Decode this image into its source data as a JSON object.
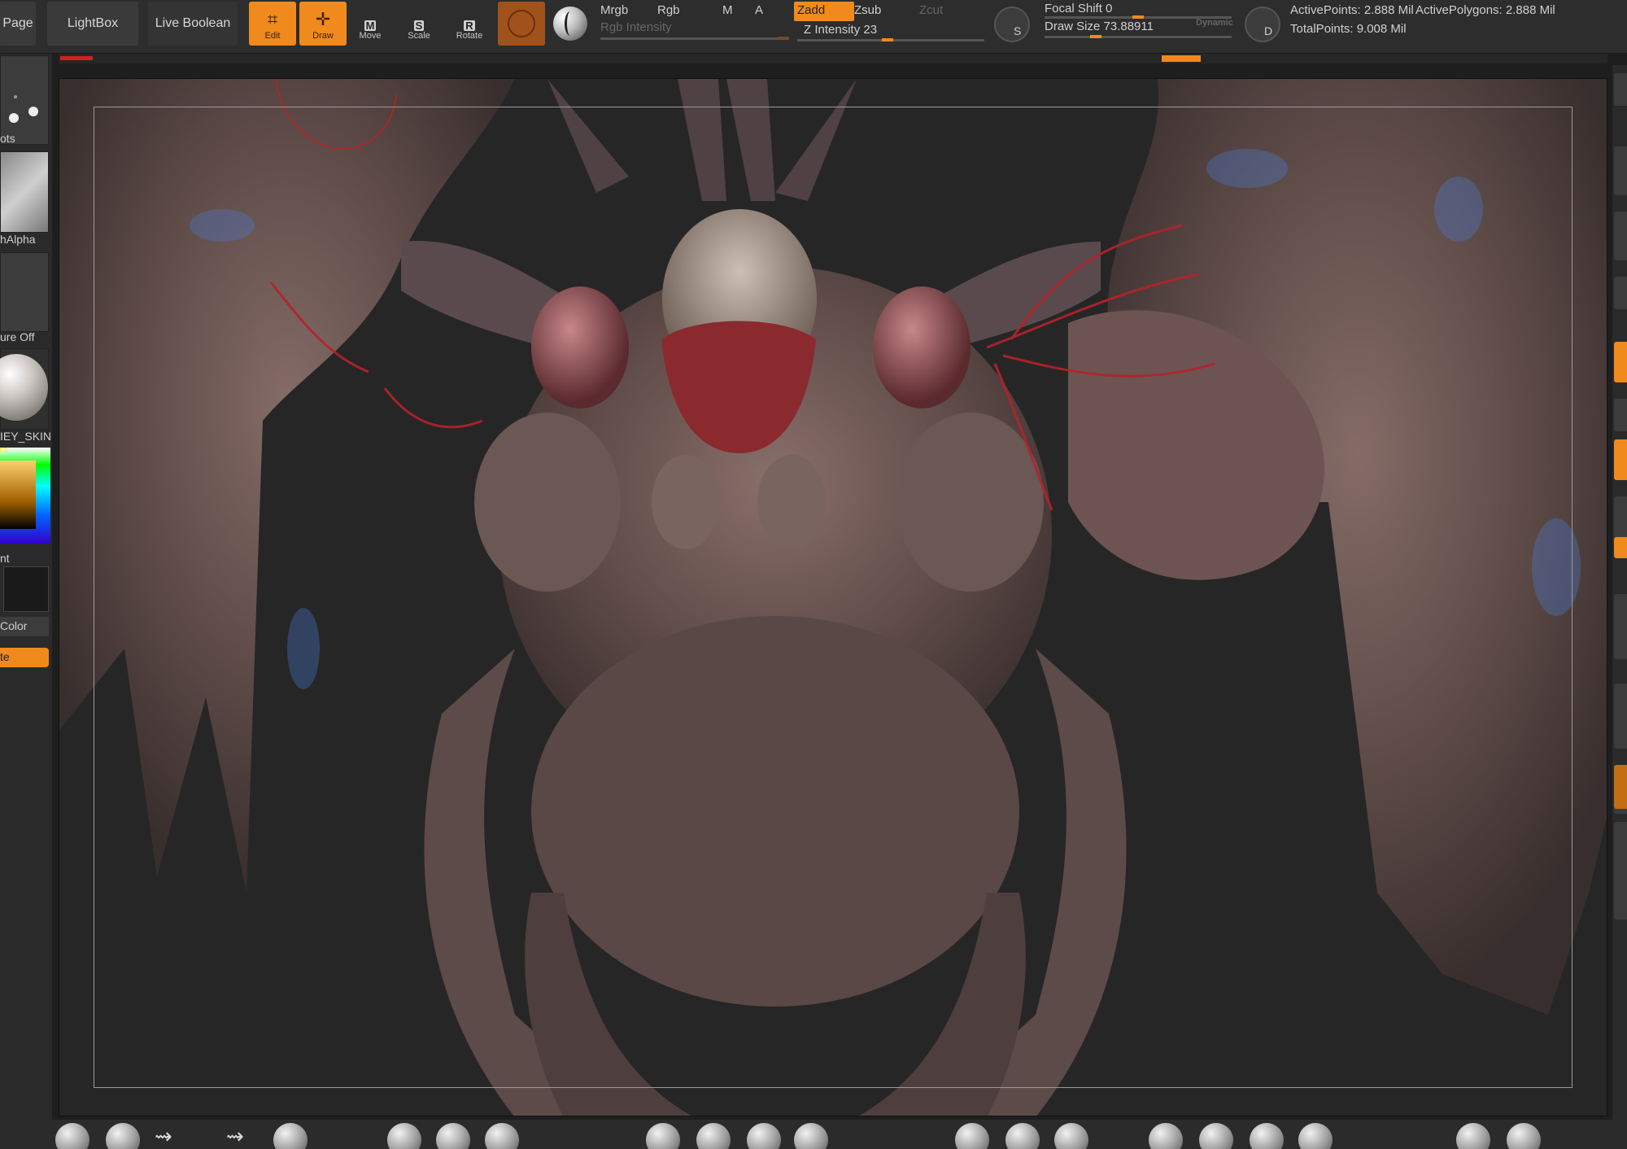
{
  "topbar": {
    "page_label": "Page",
    "lightbox_label": "LightBox",
    "live_boolean_label": "Live Boolean",
    "tools": {
      "edit": {
        "label": "Edit"
      },
      "draw": {
        "label": "Draw"
      },
      "move": {
        "label": "Move",
        "key": "M"
      },
      "scale": {
        "label": "Scale",
        "key": "S"
      },
      "rotate": {
        "label": "Rotate",
        "key": "R"
      }
    },
    "mrgb": "Mrgb",
    "rgb": "Rgb",
    "m": "M",
    "a": "A",
    "rgb_intensity": "Rgb Intensity",
    "zadd": "Zadd",
    "zsub": "Zsub",
    "zcut": "Zcut",
    "z_intensity": "Z Intensity 23",
    "focal_shift": "Focal Shift 0",
    "draw_size": "Draw Size 73.88911",
    "dynamic": "Dynamic",
    "brush_s_key": "S",
    "brush_d_key": "D",
    "active_points": "ActivePoints: 2.888 Mil",
    "active_polygons": "ActivePolygons: 2.888 Mil",
    "total_points": "TotalPoints: 9.008 Mil"
  },
  "z_intensity_level": 0.23,
  "leftshelf": {
    "dots_label": "ots",
    "alpha_label": "hAlpha",
    "texture_label": "ure Off",
    "material_label": "IEY_SKIN",
    "gradient_label": "nt",
    "color_label": "Color",
    "orange_button_label": "te"
  },
  "colors": {
    "accent": "#f08a1c",
    "toolbar_bg": "#2d2d2d",
    "viewport_bg": "#262626"
  }
}
